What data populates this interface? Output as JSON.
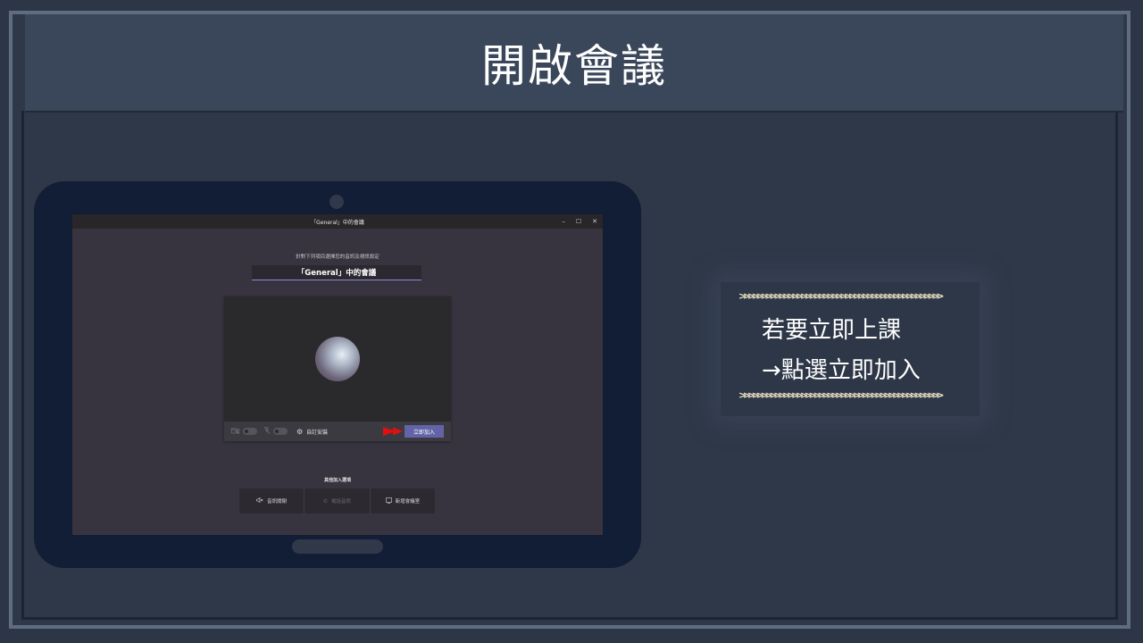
{
  "slide": {
    "title": "開啟會議"
  },
  "teams_window": {
    "window_title": "「General」中的會議",
    "controls": {
      "minimize": "–",
      "maximize": "☐",
      "close": "✕"
    },
    "prompt": "針對下列項目選擇您的音訊及視訊設定",
    "meeting_name": "「General」中的會議",
    "toolbar": {
      "video_icon": "video-off-icon",
      "mic_icon": "mic-off-icon",
      "gear_icon": "gear-icon",
      "custom_setup": "自訂安裝",
      "join_now": "立即加入"
    },
    "other_options_label": "其他加入選項",
    "other_options": [
      {
        "label": "音訊關閉",
        "icon": "speaker-off-icon",
        "enabled": true
      },
      {
        "label": "電話音訊",
        "icon": "phone-icon",
        "enabled": false
      },
      {
        "label": "新增會議室",
        "icon": "room-icon",
        "enabled": true
      }
    ]
  },
  "callout": {
    "chevrons": ">>>>>>>>>>>>>>>>>>>>>>>>>>>>>>>>>>>>>>>>>>>>>>",
    "line1": "若要立即上課",
    "line2": "→點選立即加入"
  },
  "colors": {
    "slide_bg": "#2c3646",
    "title_bar": "#3a475a",
    "tablet": "#121d36",
    "teams_accent": "#6264a7",
    "arrow_red": "#e01010",
    "chevron": "#f4e8c8"
  }
}
